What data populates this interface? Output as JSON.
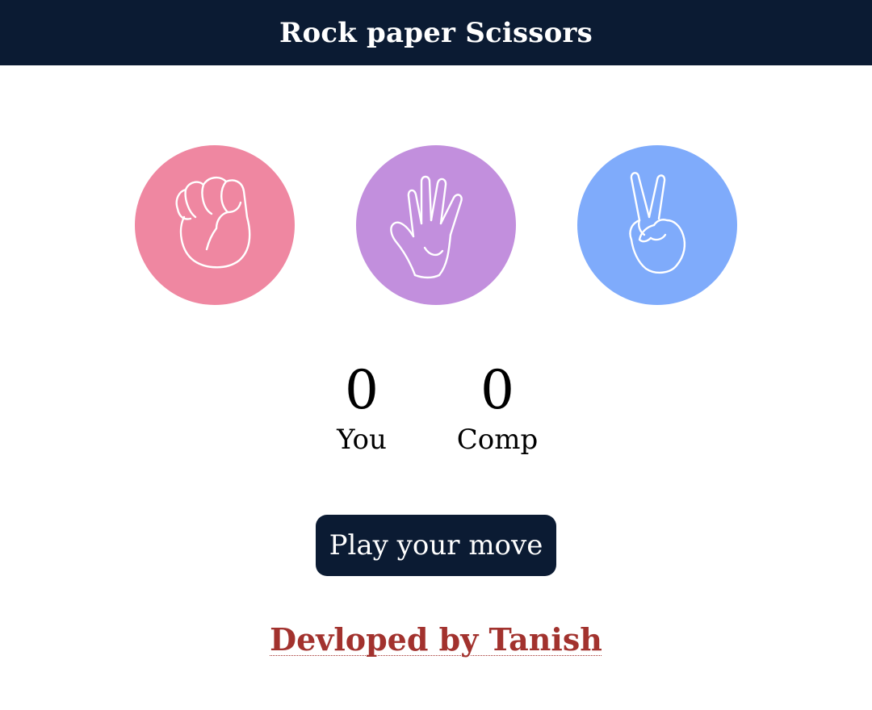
{
  "header": {
    "title": "Rock paper Scissors",
    "background": "#0b1b33"
  },
  "choices": [
    {
      "name": "rock",
      "icon": "fist-icon",
      "color": "#ef87a1"
    },
    {
      "name": "paper",
      "icon": "open-hand-icon",
      "color": "#c28fdd"
    },
    {
      "name": "scissors",
      "icon": "peace-sign-icon",
      "color": "#7fabfb"
    }
  ],
  "scoreboard": {
    "user_score": "0",
    "user_label": "You",
    "comp_score": "0",
    "comp_label": "Comp"
  },
  "message": {
    "label": "Play your move",
    "background": "#0b1b33"
  },
  "footer": {
    "text": "Devloped by Tanish",
    "color": "#a2322e"
  }
}
